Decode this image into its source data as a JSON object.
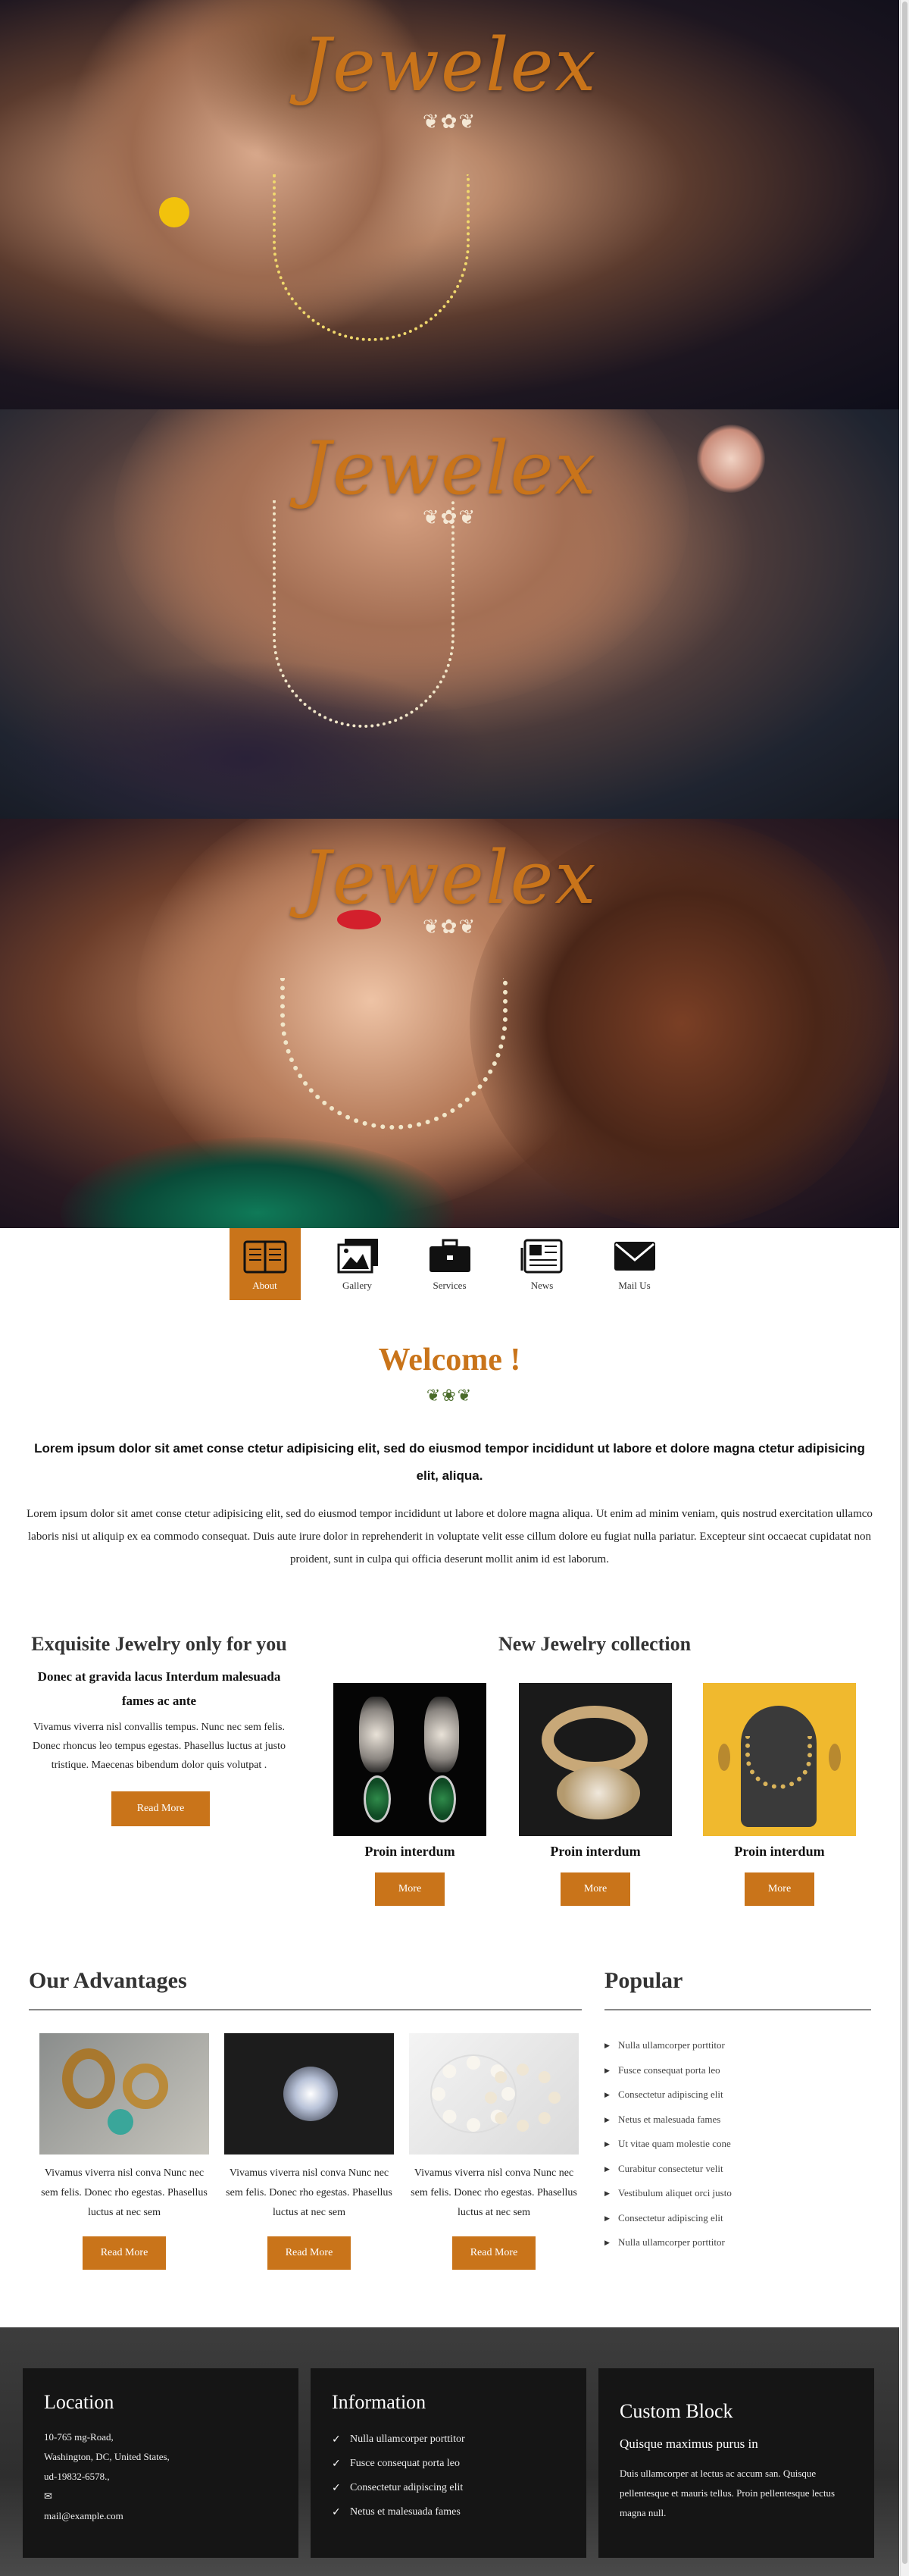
{
  "brand": {
    "logo_text": "Jewelex",
    "flourish": "❦✿❦"
  },
  "colors": {
    "accent": "#c9741a",
    "dark": "#151515",
    "footer_bg": "#2e2e2e"
  },
  "nav": {
    "items": [
      {
        "label": "About",
        "icon": "book-icon",
        "active": true
      },
      {
        "label": "Gallery",
        "icon": "pictures-icon",
        "active": false
      },
      {
        "label": "Services",
        "icon": "briefcase-icon",
        "active": false
      },
      {
        "label": "News",
        "icon": "newspaper-icon",
        "active": false
      },
      {
        "label": "Mail Us",
        "icon": "envelope-icon",
        "active": false
      }
    ]
  },
  "welcome": {
    "title": "Welcome !",
    "flourish": "❦❀❦",
    "bold_text": "Lorem ipsum dolor sit amet conse ctetur adipisicing elit, sed do eiusmod tempor incididunt ut labore et dolore magna ctetur adipisicing elit, aliqua.",
    "body_text": "Lorem ipsum dolor sit amet conse ctetur adipisicing elit, sed do eiusmod tempor incididunt ut labore et dolore magna aliqua. Ut enim ad minim veniam, quis nostrud exercitation ullamco laboris nisi ut aliquip ex ea commodo consequat. Duis aute irure dolor in reprehenderit in voluptate velit esse cillum dolore eu fugiat nulla pariatur. Excepteur sint occaecat cupidatat non proident, sunt in culpa qui officia deserunt mollit anim id est laborum."
  },
  "exquisite": {
    "title": "Exquisite Jewelry only for you",
    "subtitle": "Donec at gravida lacus Interdum malesuada fames ac ante",
    "text": "Vivamus viverra nisl convallis tempus. Nunc nec sem felis. Donec rhoncus leo tempus egestas. Phasellus luctus at justo tristique. Maecenas bibendum dolor quis volutpat .",
    "button": "Read More"
  },
  "collection": {
    "title": "New Jewelry collection",
    "items": [
      {
        "caption": "Proin interdum",
        "button": "More"
      },
      {
        "caption": "Proin interdum",
        "button": "More"
      },
      {
        "caption": "Proin interdum",
        "button": "More"
      }
    ]
  },
  "advantages": {
    "title": "Our Advantages",
    "items": [
      {
        "text": "Vivamus viverra nisl conva Nunc nec sem felis. Donec rho egestas. Phasellus luctus at nec sem",
        "button": "Read More"
      },
      {
        "text": "Vivamus viverra nisl conva Nunc nec sem felis. Donec rho egestas. Phasellus luctus at nec sem",
        "button": "Read More"
      },
      {
        "text": "Vivamus viverra nisl conva Nunc nec sem felis. Donec rho egestas. Phasellus luctus at nec sem",
        "button": "Read More"
      }
    ]
  },
  "popular": {
    "title": "Popular",
    "items": [
      "Nulla ullamcorper porttitor",
      "Fusce consequat porta leo",
      "Consectetur adipiscing elit",
      "Netus et malesuada fames",
      "Ut vitae quam molestie cone",
      "Curabitur consectetur velit",
      "Vestibulum aliquet orci justo",
      "Consectetur adipiscing elit",
      "Nulla ullamcorper porttitor"
    ]
  },
  "footer": {
    "location": {
      "title": "Location",
      "address1": "10-765 mg-Road,",
      "address2": "Washington, DC, United States,",
      "phone": "ud-19832-6578.,",
      "email": "mail@example.com"
    },
    "information": {
      "title": "Information",
      "items": [
        "Nulla ullamcorper porttitor",
        "Fusce consequat porta leo",
        "Consectetur adipiscing elit",
        "Netus et malesuada fames"
      ]
    },
    "custom": {
      "title": "Custom Block",
      "subtitle": "Quisque maximus purus in",
      "text": "Duis ullamcorper at lectus ac accum san. Quisque pellentesque et mauris tellus. Proin pellentesque lectus magna null."
    }
  }
}
